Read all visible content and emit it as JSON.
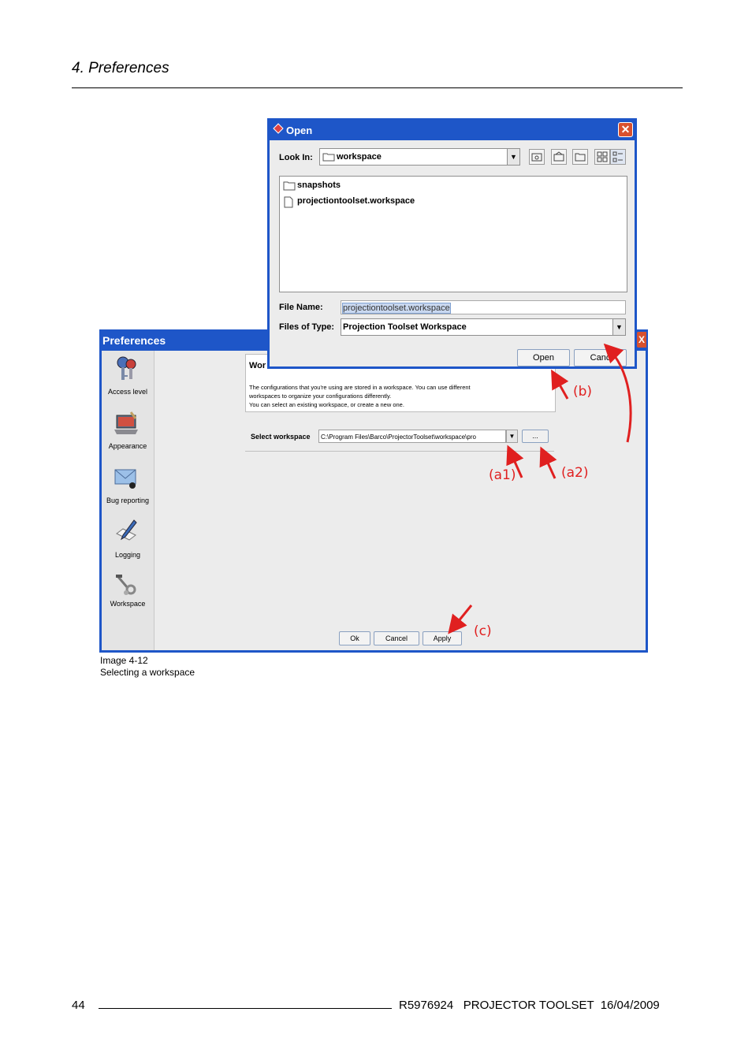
{
  "page": {
    "chapter": "4.  Preferences",
    "number": "44",
    "doc_id": "R5976924",
    "product": "PROJECTOR TOOLSET",
    "date": "16/04/2009"
  },
  "caption": {
    "ref": "Image 4-12",
    "text": "Selecting a workspace"
  },
  "preferences": {
    "title": "Preferences",
    "close": "X",
    "sidebar": [
      {
        "label": "Access level",
        "icon": "keys-icon"
      },
      {
        "label": "Appearance",
        "icon": "paint-laptop-icon"
      },
      {
        "label": "Bug reporting",
        "icon": "envelope-bug-icon"
      },
      {
        "label": "Logging",
        "icon": "pen-paper-icon"
      },
      {
        "label": "Workspace",
        "icon": "tools-icon"
      }
    ],
    "info_title": "Wor",
    "info_text": [
      "The configurations that you're using are stored in a workspace. You can use different",
      "workspaces to organize your configurations differently.",
      "You can select an existing workspace, or create a new one."
    ],
    "select_label": "Select workspace",
    "select_value": "C:\\Program Files\\Barco\\ProjectorToolset\\workspace\\pro",
    "browse": "...",
    "buttons": {
      "ok": "Ok",
      "cancel": "Cancel",
      "apply": "Apply"
    }
  },
  "open_dialog": {
    "title": "Open",
    "look_in_label": "Look In:",
    "look_in_value": "workspace",
    "files": [
      {
        "name": "snapshots",
        "kind": "folder"
      },
      {
        "name": "projectiontoolset.workspace",
        "kind": "file"
      }
    ],
    "file_name_label": "File Name:",
    "file_name_value": "projectiontoolset.workspace",
    "type_label": "Files of Type:",
    "type_value": "Projection Toolset Workspace",
    "buttons": {
      "open": "Open",
      "cancel": "Canc"
    }
  },
  "annotations": {
    "b": "(b)",
    "a1": "(a1)",
    "a2": "(a2)",
    "c": "(c)"
  },
  "colors": {
    "titlebar": "#1e56c8",
    "close": "#d8502e",
    "arrow": "#e02020"
  }
}
